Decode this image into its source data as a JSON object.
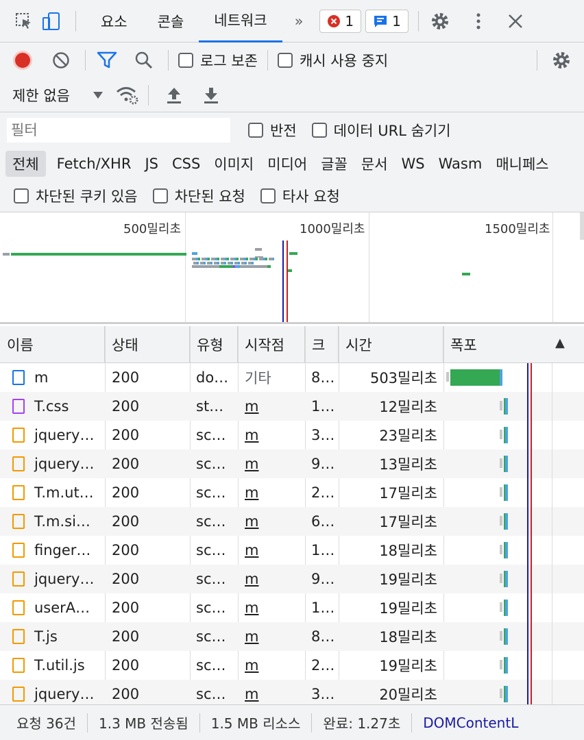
{
  "topbar": {
    "tabs": [
      "요소",
      "콘솔",
      "네트워크"
    ],
    "more": "»",
    "errors": "1",
    "messages": "1"
  },
  "toolbar": {
    "preserve_log": "로그 보존",
    "disable_cache": "캐시 사용 중지",
    "throttle": "제한 없음"
  },
  "filter": {
    "placeholder": "필터",
    "invert": "반전",
    "hide_data_urls": "데이터 URL 숨기기",
    "types": [
      "전체",
      "Fetch/XHR",
      "JS",
      "CSS",
      "이미지",
      "미디어",
      "글꼴",
      "문서",
      "WS",
      "Wasm",
      "매니페스"
    ],
    "blocked_cookies": "차단된 쿠키 있음",
    "blocked_requests": "차단된 요청",
    "third_party": "타사 요청"
  },
  "overview": {
    "ticks": [
      "500밀리초",
      "1000밀리초",
      "1500밀리초"
    ]
  },
  "table": {
    "headers": [
      "이름",
      "상태",
      "유형",
      "시작점",
      "크",
      "시간",
      "폭포"
    ],
    "sort_indicator": "▲",
    "rows": [
      {
        "name": "m",
        "status": "200",
        "type": "do…",
        "initiator": "기타",
        "size": "8…",
        "time": "503밀리초",
        "kind": "doc",
        "initiator_link": false,
        "wf_start": 0.03,
        "wf_len": 0.48
      },
      {
        "name": "T.css",
        "status": "200",
        "type": "st…",
        "initiator": "m",
        "size": "1…",
        "time": "12밀리초",
        "kind": "css",
        "initiator_link": true,
        "wf_start": 0.55,
        "wf_len": 0.02
      },
      {
        "name": "jquery…",
        "status": "200",
        "type": "sc…",
        "initiator": "m",
        "size": "3…",
        "time": "23밀리초",
        "kind": "js",
        "initiator_link": true,
        "wf_start": 0.55,
        "wf_len": 0.04
      },
      {
        "name": "jquery…",
        "status": "200",
        "type": "sc…",
        "initiator": "m",
        "size": "9…",
        "time": "13밀리초",
        "kind": "js",
        "initiator_link": true,
        "wf_start": 0.55,
        "wf_len": 0.03
      },
      {
        "name": "T.m.ut…",
        "status": "200",
        "type": "sc…",
        "initiator": "m",
        "size": "2…",
        "time": "17밀리초",
        "kind": "js",
        "initiator_link": true,
        "wf_start": 0.55,
        "wf_len": 0.03
      },
      {
        "name": "T.m.si…",
        "status": "200",
        "type": "sc…",
        "initiator": "m",
        "size": "6…",
        "time": "17밀리초",
        "kind": "js",
        "initiator_link": true,
        "wf_start": 0.55,
        "wf_len": 0.03
      },
      {
        "name": "finger…",
        "status": "200",
        "type": "sc…",
        "initiator": "m",
        "size": "1…",
        "time": "18밀리초",
        "kind": "js",
        "initiator_link": true,
        "wf_start": 0.55,
        "wf_len": 0.03
      },
      {
        "name": "jquery…",
        "status": "200",
        "type": "sc…",
        "initiator": "m",
        "size": "9…",
        "time": "19밀리초",
        "kind": "js",
        "initiator_link": true,
        "wf_start": 0.55,
        "wf_len": 0.03
      },
      {
        "name": "userA…",
        "status": "200",
        "type": "sc…",
        "initiator": "m",
        "size": "1…",
        "time": "19밀리초",
        "kind": "js",
        "initiator_link": true,
        "wf_start": 0.55,
        "wf_len": 0.03
      },
      {
        "name": "T.js",
        "status": "200",
        "type": "sc…",
        "initiator": "m",
        "size": "8…",
        "time": "18밀리초",
        "kind": "js",
        "initiator_link": true,
        "wf_start": 0.55,
        "wf_len": 0.03
      },
      {
        "name": "T.util.js",
        "status": "200",
        "type": "sc…",
        "initiator": "m",
        "size": "2…",
        "time": "19밀리초",
        "kind": "js",
        "initiator_link": true,
        "wf_start": 0.55,
        "wf_len": 0.03
      },
      {
        "name": "jquery…",
        "status": "200",
        "type": "sc…",
        "initiator": "m",
        "size": "3…",
        "time": "20밀리초",
        "kind": "js",
        "initiator_link": true,
        "wf_start": 0.55,
        "wf_len": 0.03
      }
    ]
  },
  "status": {
    "requests": "요청 36건",
    "transferred": "1.3 MB 전송됨",
    "resources": "1.5 MB 리소스",
    "finish": "완료: 1.27초",
    "domcontent": "DOMContentL"
  },
  "colors": {
    "accent": "#1a73e8",
    "record": "#d93025",
    "bar_green": "#34a853",
    "bar_blue": "#4fa3e0",
    "dcl_line": "#1a1aa6",
    "load_line": "#c5221f"
  }
}
